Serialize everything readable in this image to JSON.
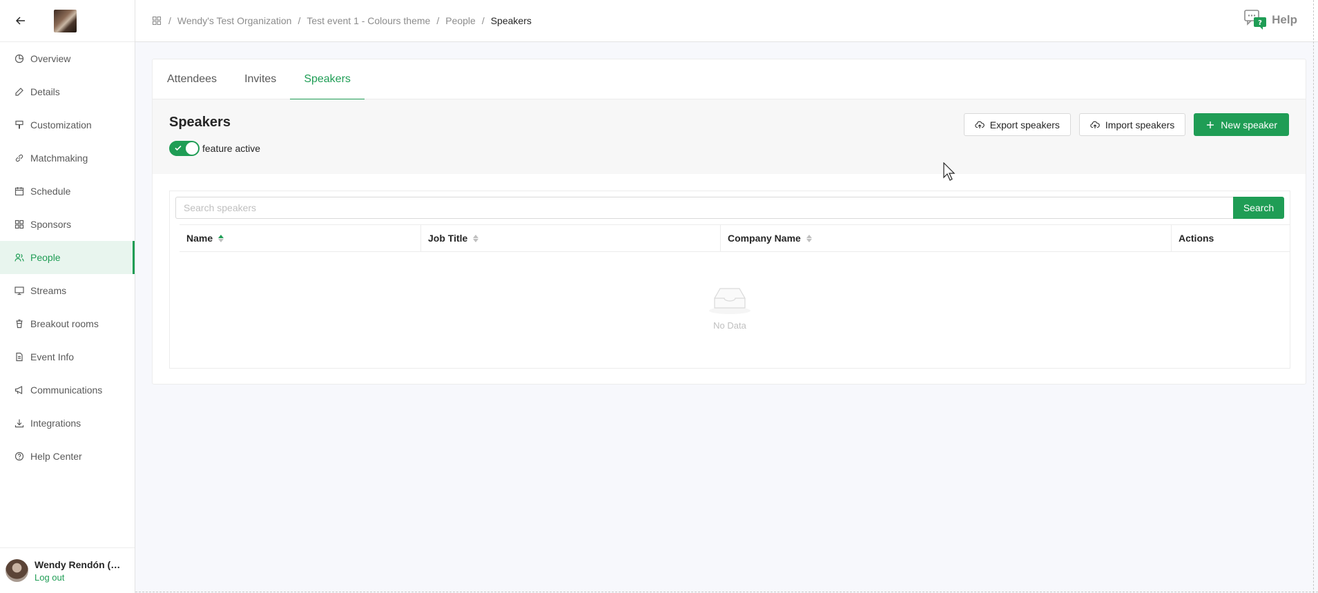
{
  "sidebar": {
    "items": [
      {
        "label": "Overview",
        "icon": "pie-chart-icon"
      },
      {
        "label": "Details",
        "icon": "edit-icon"
      },
      {
        "label": "Customization",
        "icon": "paint-brush-icon"
      },
      {
        "label": "Matchmaking",
        "icon": "link-icon"
      },
      {
        "label": "Schedule",
        "icon": "calendar-icon"
      },
      {
        "label": "Sponsors",
        "icon": "grid-icon"
      },
      {
        "label": "People",
        "icon": "people-icon"
      },
      {
        "label": "Streams",
        "icon": "monitor-icon"
      },
      {
        "label": "Breakout rooms",
        "icon": "trash-cup-icon"
      },
      {
        "label": "Event Info",
        "icon": "document-icon"
      },
      {
        "label": "Communications",
        "icon": "megaphone-icon"
      },
      {
        "label": "Integrations",
        "icon": "download-icon"
      },
      {
        "label": "Help Center",
        "icon": "question-circle-icon"
      }
    ],
    "active_index": 6,
    "user": {
      "name": "Wendy Rendón (B...",
      "logout": "Log out"
    }
  },
  "breadcrumb": {
    "items": [
      "Wendy's Test Organization",
      "Test event 1 - Colours theme",
      "People",
      "Speakers"
    ],
    "separator": "/"
  },
  "header": {
    "help_label": "Help"
  },
  "tabs": [
    "Attendees",
    "Invites",
    "Speakers"
  ],
  "active_tab": 2,
  "section": {
    "title": "Speakers",
    "toggle_label": "feature active",
    "toggle_on": true,
    "export_label": "Export speakers",
    "import_label": "Import speakers",
    "new_label": "New speaker"
  },
  "search": {
    "placeholder": "Search speakers",
    "button": "Search"
  },
  "table": {
    "columns": [
      "Name",
      "Job Title",
      "Company Name",
      "Actions"
    ],
    "empty_text": "No Data"
  },
  "colors": {
    "accent": "#1f9d55"
  }
}
